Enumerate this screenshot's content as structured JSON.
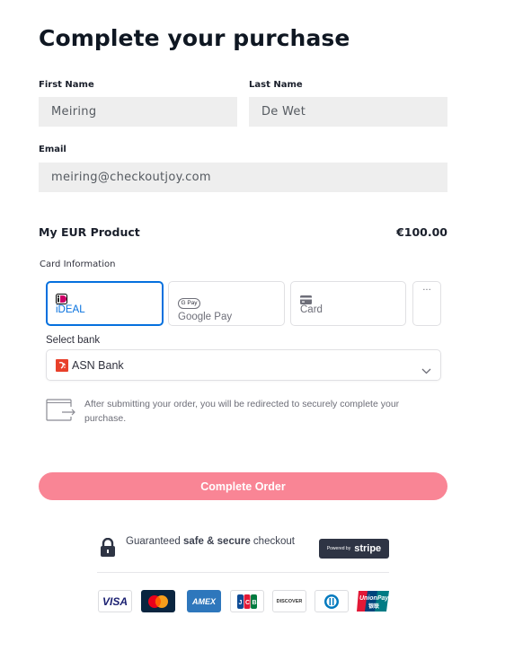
{
  "page": {
    "title": "Complete your purchase"
  },
  "form": {
    "first_name": {
      "label": "First Name",
      "value": "Meiring"
    },
    "last_name": {
      "label": "Last Name",
      "value": "De Wet"
    },
    "email": {
      "label": "Email",
      "value": "meiring@checkoutjoy.com"
    }
  },
  "product": {
    "name": "My EUR Product",
    "price": "€100.00"
  },
  "payment": {
    "section_label": "Card Information",
    "tabs": [
      {
        "label": "iDEAL",
        "icon": "ideal-icon",
        "active": true
      },
      {
        "label": "Google Pay",
        "icon": "google-pay-icon",
        "badge": "G Pay",
        "active": false
      },
      {
        "label": "Card",
        "icon": "credit-card-icon",
        "active": false
      }
    ],
    "more_label": "···",
    "bank": {
      "label": "Select bank",
      "selected": "ASN Bank"
    },
    "redirect_notice": "After submitting your order, you will be redirected to securely complete your purchase."
  },
  "submit": {
    "label": "Complete Order"
  },
  "trust": {
    "secure_prefix": "Guaranteed ",
    "secure_bold": "safe & secure",
    "secure_suffix": " checkout",
    "stripe_powered": "Powered by",
    "stripe_brand": "stripe"
  },
  "card_logos": [
    {
      "name": "VISA"
    },
    {
      "name": "Mastercard"
    },
    {
      "name": "AMEX"
    },
    {
      "name": "JCB"
    },
    {
      "name": "DISCOVER"
    },
    {
      "name": "Diners Club"
    },
    {
      "name": "UnionPay",
      "sub": "银联"
    }
  ],
  "colors": {
    "accent": "#0570de",
    "button": "#f98595",
    "stripe_badge": "#2e3444",
    "ideal": "#cc0066"
  }
}
